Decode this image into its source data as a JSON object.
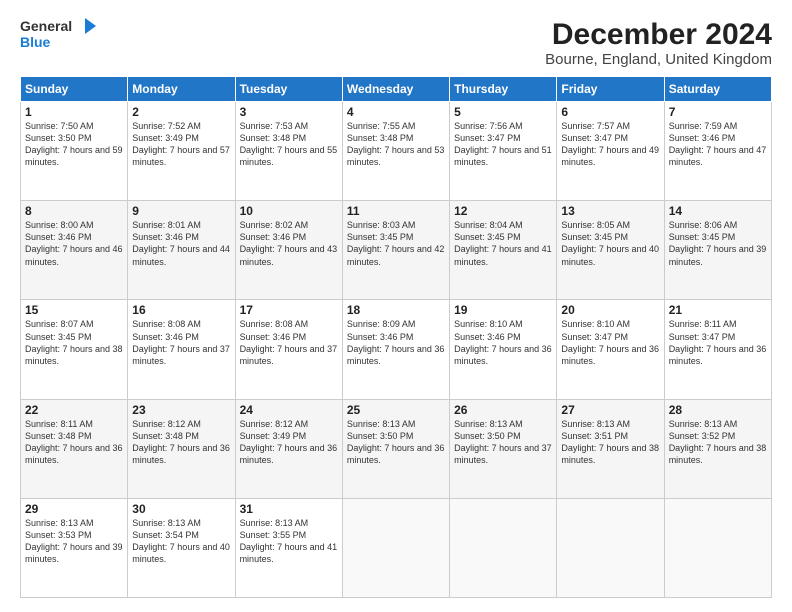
{
  "logo": {
    "line1": "General",
    "line2": "Blue"
  },
  "header": {
    "title": "December 2024",
    "subtitle": "Bourne, England, United Kingdom"
  },
  "days": [
    "Sunday",
    "Monday",
    "Tuesday",
    "Wednesday",
    "Thursday",
    "Friday",
    "Saturday"
  ],
  "weeks": [
    [
      {
        "num": "1",
        "rise": "7:50 AM",
        "set": "3:50 PM",
        "daylight": "7 hours and 59 minutes."
      },
      {
        "num": "2",
        "rise": "7:52 AM",
        "set": "3:49 PM",
        "daylight": "7 hours and 57 minutes."
      },
      {
        "num": "3",
        "rise": "7:53 AM",
        "set": "3:48 PM",
        "daylight": "7 hours and 55 minutes."
      },
      {
        "num": "4",
        "rise": "7:55 AM",
        "set": "3:48 PM",
        "daylight": "7 hours and 53 minutes."
      },
      {
        "num": "5",
        "rise": "7:56 AM",
        "set": "3:47 PM",
        "daylight": "7 hours and 51 minutes."
      },
      {
        "num": "6",
        "rise": "7:57 AM",
        "set": "3:47 PM",
        "daylight": "7 hours and 49 minutes."
      },
      {
        "num": "7",
        "rise": "7:59 AM",
        "set": "3:46 PM",
        "daylight": "7 hours and 47 minutes."
      }
    ],
    [
      {
        "num": "8",
        "rise": "8:00 AM",
        "set": "3:46 PM",
        "daylight": "7 hours and 46 minutes."
      },
      {
        "num": "9",
        "rise": "8:01 AM",
        "set": "3:46 PM",
        "daylight": "7 hours and 44 minutes."
      },
      {
        "num": "10",
        "rise": "8:02 AM",
        "set": "3:46 PM",
        "daylight": "7 hours and 43 minutes."
      },
      {
        "num": "11",
        "rise": "8:03 AM",
        "set": "3:45 PM",
        "daylight": "7 hours and 42 minutes."
      },
      {
        "num": "12",
        "rise": "8:04 AM",
        "set": "3:45 PM",
        "daylight": "7 hours and 41 minutes."
      },
      {
        "num": "13",
        "rise": "8:05 AM",
        "set": "3:45 PM",
        "daylight": "7 hours and 40 minutes."
      },
      {
        "num": "14",
        "rise": "8:06 AM",
        "set": "3:45 PM",
        "daylight": "7 hours and 39 minutes."
      }
    ],
    [
      {
        "num": "15",
        "rise": "8:07 AM",
        "set": "3:45 PM",
        "daylight": "7 hours and 38 minutes."
      },
      {
        "num": "16",
        "rise": "8:08 AM",
        "set": "3:46 PM",
        "daylight": "7 hours and 37 minutes."
      },
      {
        "num": "17",
        "rise": "8:08 AM",
        "set": "3:46 PM",
        "daylight": "7 hours and 37 minutes."
      },
      {
        "num": "18",
        "rise": "8:09 AM",
        "set": "3:46 PM",
        "daylight": "7 hours and 36 minutes."
      },
      {
        "num": "19",
        "rise": "8:10 AM",
        "set": "3:46 PM",
        "daylight": "7 hours and 36 minutes."
      },
      {
        "num": "20",
        "rise": "8:10 AM",
        "set": "3:47 PM",
        "daylight": "7 hours and 36 minutes."
      },
      {
        "num": "21",
        "rise": "8:11 AM",
        "set": "3:47 PM",
        "daylight": "7 hours and 36 minutes."
      }
    ],
    [
      {
        "num": "22",
        "rise": "8:11 AM",
        "set": "3:48 PM",
        "daylight": "7 hours and 36 minutes."
      },
      {
        "num": "23",
        "rise": "8:12 AM",
        "set": "3:48 PM",
        "daylight": "7 hours and 36 minutes."
      },
      {
        "num": "24",
        "rise": "8:12 AM",
        "set": "3:49 PM",
        "daylight": "7 hours and 36 minutes."
      },
      {
        "num": "25",
        "rise": "8:13 AM",
        "set": "3:50 PM",
        "daylight": "7 hours and 36 minutes."
      },
      {
        "num": "26",
        "rise": "8:13 AM",
        "set": "3:50 PM",
        "daylight": "7 hours and 37 minutes."
      },
      {
        "num": "27",
        "rise": "8:13 AM",
        "set": "3:51 PM",
        "daylight": "7 hours and 38 minutes."
      },
      {
        "num": "28",
        "rise": "8:13 AM",
        "set": "3:52 PM",
        "daylight": "7 hours and 38 minutes."
      }
    ],
    [
      {
        "num": "29",
        "rise": "8:13 AM",
        "set": "3:53 PM",
        "daylight": "7 hours and 39 minutes."
      },
      {
        "num": "30",
        "rise": "8:13 AM",
        "set": "3:54 PM",
        "daylight": "7 hours and 40 minutes."
      },
      {
        "num": "31",
        "rise": "8:13 AM",
        "set": "3:55 PM",
        "daylight": "7 hours and 41 minutes."
      },
      null,
      null,
      null,
      null
    ]
  ]
}
